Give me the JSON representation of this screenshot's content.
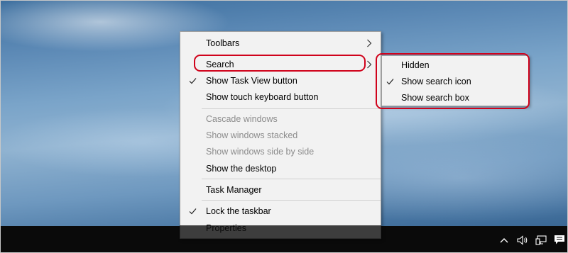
{
  "context_menu": {
    "items": [
      {
        "label": "Toolbars",
        "checked": false,
        "disabled": false,
        "submenu": true
      },
      {
        "label": "Search",
        "checked": false,
        "disabled": false,
        "submenu": true
      },
      {
        "label": "Show Task View button",
        "checked": true,
        "disabled": false
      },
      {
        "label": "Show touch keyboard button",
        "checked": false,
        "disabled": false
      },
      {
        "label": "Cascade windows",
        "checked": false,
        "disabled": true
      },
      {
        "label": "Show windows stacked",
        "checked": false,
        "disabled": true
      },
      {
        "label": "Show windows side by side",
        "checked": false,
        "disabled": true
      },
      {
        "label": "Show the desktop",
        "checked": false,
        "disabled": false
      },
      {
        "label": "Task Manager",
        "checked": false,
        "disabled": false
      },
      {
        "label": "Lock the taskbar",
        "checked": true,
        "disabled": false
      },
      {
        "label": "Properties",
        "checked": false,
        "disabled": false
      }
    ]
  },
  "search_submenu": {
    "items": [
      {
        "label": "Hidden",
        "checked": false
      },
      {
        "label": "Show search icon",
        "checked": true
      },
      {
        "label": "Show search box",
        "checked": false
      }
    ]
  },
  "tray": {
    "icons": [
      "chevron-up-icon",
      "volume-icon",
      "network-icon",
      "action-center-icon"
    ]
  },
  "colors": {
    "menu_background": "#f2f2f2",
    "highlight_outline": "#d0021b",
    "taskbar": "#0a0a0a",
    "disabled_text": "#8c8c8c"
  }
}
